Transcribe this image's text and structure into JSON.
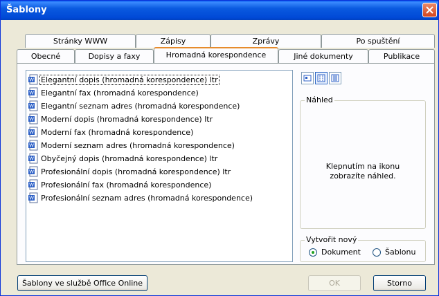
{
  "window": {
    "title": "Šablony"
  },
  "tabs_row1": [
    "Stránky WWW",
    "Zápisy",
    "Zprávy",
    "Po spuštění"
  ],
  "tabs_row2": [
    "Obecné",
    "Dopisy a faxy",
    "Hromadná korespondence",
    "Jiné dokumenty",
    "Publikace"
  ],
  "active_tab": "Hromadná korespondence",
  "templates": [
    "Elegantní dopis (hromadná korespondence) ltr",
    "Elegantní fax (hromadná korespondence)",
    "Elegantní seznam adres (hromadná korespondence)",
    "Moderní dopis (hromadná korespondence) ltr",
    "Moderní fax (hromadná korespondence)",
    "Moderní seznam adres (hromadná korespondence)",
    "Obyčejný dopis (hromadná korespondence) ltr",
    "Profesionální dopis (hromadná korespondence) ltr",
    "Profesionální fax (hromadná korespondence)",
    "Profesionální seznam adres (hromadná korespondence)"
  ],
  "view_icons": [
    "large-icons-view-icon",
    "list-view-icon",
    "details-view-icon"
  ],
  "preview": {
    "label": "Náhled",
    "message_line1": "Klepnutím na ikonu",
    "message_line2": "zobrazíte náhled."
  },
  "create_new": {
    "label": "Vytvořit nový",
    "option_document": "Dokument",
    "option_template": "Šablonu",
    "selected": "Dokument"
  },
  "buttons": {
    "office_online": "Šablony ve službě Office Online",
    "ok": "OK",
    "cancel": "Storno"
  },
  "colors": {
    "titlebar": "#0a5ae0",
    "close_button": "#d3451f",
    "active_tab_accent": "#e68b2c"
  }
}
